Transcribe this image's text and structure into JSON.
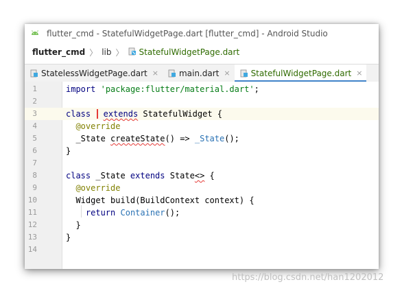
{
  "window": {
    "title": "flutter_cmd - StatefulWidgetPage.dart [flutter_cmd] - Android Studio"
  },
  "breadcrumb": {
    "project": "flutter_cmd",
    "folder": "lib",
    "file": "StatefulWidgetPage.dart"
  },
  "tabs": [
    {
      "label": "StatelessWidgetPage.dart",
      "active": false,
      "icon": "dart-file-icon"
    },
    {
      "label": "main.dart",
      "active": false,
      "icon": "dart-file-icon"
    },
    {
      "label": "StatefulWidgetPage.dart",
      "active": true,
      "icon": "dart-file-icon"
    }
  ],
  "tab_close_symbol": "×",
  "editor": {
    "line_numbers": [
      "1",
      "2",
      "3",
      "4",
      "5",
      "6",
      "7",
      "8",
      "9",
      "10",
      "11",
      "12",
      "13",
      "14"
    ],
    "lines": {
      "l1": {
        "kw": "import",
        "sp": " ",
        "str": "'package:flutter/material.dart'",
        "end": ";"
      },
      "l3": {
        "kw": "class",
        "sp": " ",
        "kw2": "extends",
        "rest": " StatefulWidget {"
      },
      "l4": {
        "ann": "@override"
      },
      "l5": {
        "pre": "_State ",
        "fn": "createState",
        "mid": "() => ",
        "cls": "_State",
        "end": "();"
      },
      "l6": {
        "text": "}"
      },
      "l8": {
        "kw": "class",
        "mid": " _State ",
        "kw2": "extends",
        "rest": " State",
        "gen": "<>",
        "end": " {"
      },
      "l9": {
        "ann": "@override"
      },
      "l10": {
        "text": "Widget build(BuildContext context) {"
      },
      "l11": {
        "kw": "return",
        "sp": " ",
        "cls": "Container",
        "end": "();"
      },
      "l12": {
        "text": "}"
      },
      "l13": {
        "text": "}"
      }
    },
    "current_line": 3
  },
  "colors": {
    "keyword": "#000080",
    "string": "#067d17",
    "annotation": "#808000",
    "class_ref": "#2a72b4",
    "error_underline": "#e53935",
    "active_tab_underline": "#4083c9"
  },
  "watermark": "https://blog.csdn.net/han1202012"
}
